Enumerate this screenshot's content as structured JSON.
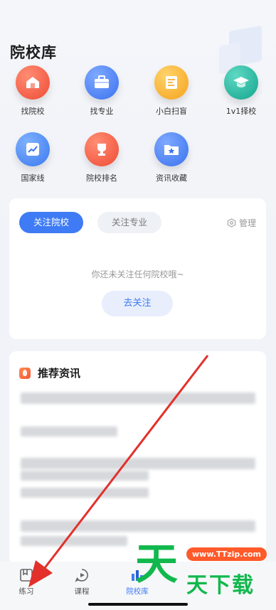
{
  "header": {
    "title": "院校库"
  },
  "grid": {
    "items": [
      {
        "label": "找院校",
        "icon": "school-icon",
        "color": "#f0533d"
      },
      {
        "label": "找专业",
        "icon": "briefcase-icon",
        "color": "#3e7bf4"
      },
      {
        "label": "小白扫盲",
        "icon": "document-icon",
        "color": "#f5a623"
      },
      {
        "label": "1v1择校",
        "icon": "graduation-cap-icon",
        "color": "#16b39c"
      },
      {
        "label": "国家线",
        "icon": "trend-chart-icon",
        "color": "#3e7bf4"
      },
      {
        "label": "院校排名",
        "icon": "trophy-icon",
        "color": "#f0533d"
      },
      {
        "label": "资讯收藏",
        "icon": "star-folder-icon",
        "color": "#3e7bf4"
      }
    ]
  },
  "follow_card": {
    "tab_schools": "关注院校",
    "tab_majors": "关注专业",
    "manage_label": "管理",
    "empty_text": "你还未关注任何院校哦~",
    "follow_button": "去关注"
  },
  "news": {
    "title": "推荐资讯"
  },
  "tabbar": {
    "practice": "练习",
    "courses": "课程",
    "school_library": "院校库"
  },
  "watermark": {
    "url": "www.TTzip.com",
    "big": "天",
    "small": "天下载"
  },
  "colors": {
    "accent": "#3e7bf4",
    "arrow": "#e3302b"
  }
}
